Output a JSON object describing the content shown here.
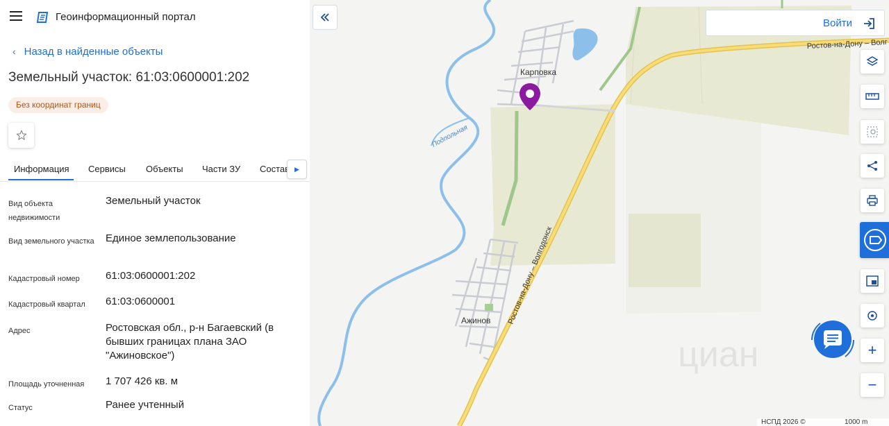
{
  "header": {
    "title": "Геоинформационный портал"
  },
  "nav": {
    "back_label": "Назад в найденные объекты"
  },
  "object": {
    "title": "Земельный участок: 61:03:0600001:202",
    "badge": "Без координат границ"
  },
  "tabs": [
    {
      "label": "Информация",
      "active": true
    },
    {
      "label": "Сервисы"
    },
    {
      "label": "Объекты"
    },
    {
      "label": "Части ЗУ"
    },
    {
      "label": "Состав"
    }
  ],
  "properties": [
    {
      "label": "Вид объекта недвижимости",
      "value": "Земельный участок"
    },
    {
      "label": "Вид земельного участка",
      "value": "Единое землепользование"
    },
    {
      "label": "Кадастровый номер",
      "value": "61:03:0600001:202"
    },
    {
      "label": "Кадастровый квартал",
      "value": "61:03:0600001"
    },
    {
      "label": "Адрес",
      "value": "Ростовская обл., р-н Багаевский (в бывших границах плана ЗАО \"Ажиновское\")"
    },
    {
      "label": "Площадь уточненная",
      "value": "1 707 426 кв. м"
    },
    {
      "label": "Статус",
      "value": "Ранее учтенный"
    }
  ],
  "map": {
    "login_label": "Войти",
    "places": [
      "Карповка",
      "Ажинов"
    ],
    "river_label": "Подпольная",
    "road_label": "Ростов-на-Дону – Волгодонск",
    "road_label_top": "Ростов-на-Дону – Волг",
    "attribution": "НСПД 2026 ©",
    "scale_label": "1000 m",
    "watermark": "циан",
    "tools": [
      "layers-icon",
      "ruler-icon",
      "area-select-icon",
      "share-icon",
      "print-icon",
      "pdf-icon",
      "minimap-icon",
      "location-icon",
      "zoom-in-icon",
      "zoom-out-icon"
    ]
  },
  "colors": {
    "accent": "#1e6fd9",
    "marker": "#8b1aa0",
    "road": "#f2cf5a",
    "field": "#e9ead4",
    "river": "#7fb6e6"
  }
}
